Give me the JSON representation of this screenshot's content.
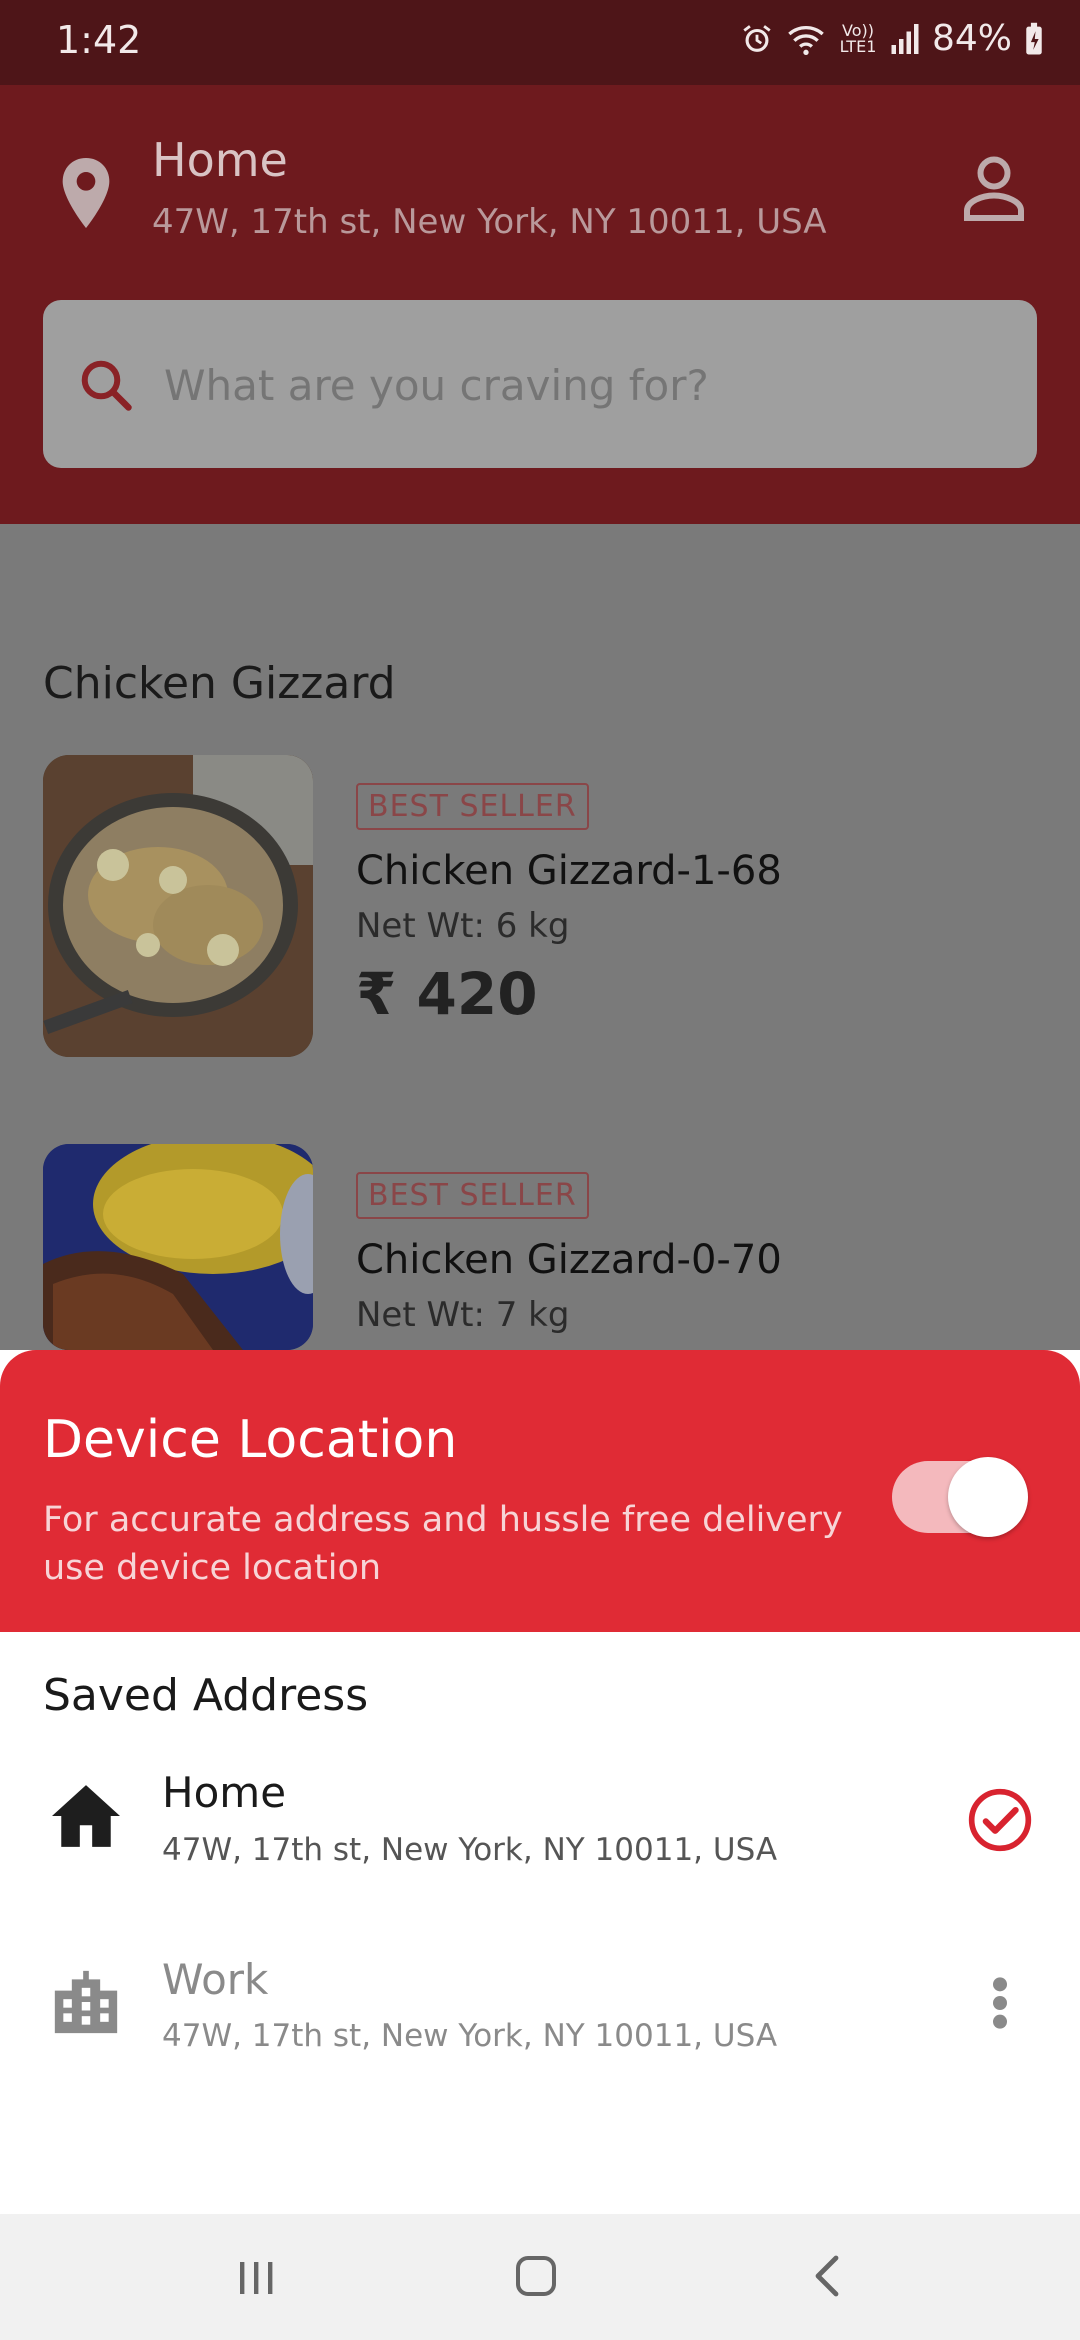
{
  "status_bar": {
    "time": "1:42",
    "network": "Vo)) LTE1",
    "battery": "84%"
  },
  "header": {
    "location_title": "Home",
    "location_address": "47W, 17th st, New York, NY 10011, USA",
    "search_placeholder": "What are you craving for?"
  },
  "content": {
    "section_title": "Chicken Gizzard",
    "products": [
      {
        "badge": "BEST SELLER",
        "name": "Chicken Gizzard-1-68",
        "weight": "Net Wt: 6 kg",
        "price": "₹ 420"
      },
      {
        "badge": "BEST SELLER",
        "name": "Chicken Gizzard-0-70",
        "weight": "Net Wt: 7 kg"
      }
    ]
  },
  "sheet": {
    "device_location_title": "Device Location",
    "device_location_desc": "For accurate address and hussle free delivery use device location",
    "toggle_on": true,
    "saved_title": "Saved Address",
    "addresses": [
      {
        "label": "Home",
        "address": "47W, 17th st, New York, NY 10011, USA",
        "selected": true
      },
      {
        "label": "Work",
        "address": "47W, 17th st, New York, NY 10011, USA",
        "selected": false
      }
    ]
  },
  "colors": {
    "header_dim": "#6e1a1e",
    "sheet_red": "#e02b35",
    "accent_red": "#d8232f"
  }
}
